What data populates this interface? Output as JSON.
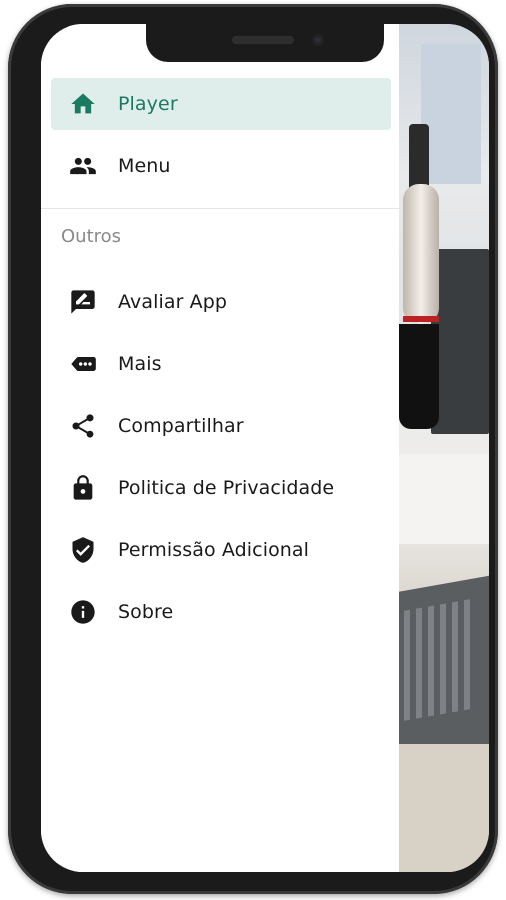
{
  "colors": {
    "accent": "#1b7a62",
    "active_bg": "#e0eeeb",
    "text": "#1a1a1a",
    "muted": "#8a8a8a"
  },
  "drawer": {
    "primary_items": [
      {
        "label": "Player",
        "icon": "home-icon",
        "active": true
      },
      {
        "label": "Menu",
        "icon": "people-icon",
        "active": false
      }
    ],
    "section_title": "Outros",
    "secondary_items": [
      {
        "label": "Avaliar App",
        "icon": "rate-review-icon"
      },
      {
        "label": "Mais",
        "icon": "more-label-icon"
      },
      {
        "label": "Compartilhar",
        "icon": "share-icon"
      },
      {
        "label": "Politica de Privacidade",
        "icon": "lock-icon"
      },
      {
        "label": "Permissão Adicional",
        "icon": "shield-check-icon"
      },
      {
        "label": "Sobre",
        "icon": "info-icon"
      }
    ]
  }
}
